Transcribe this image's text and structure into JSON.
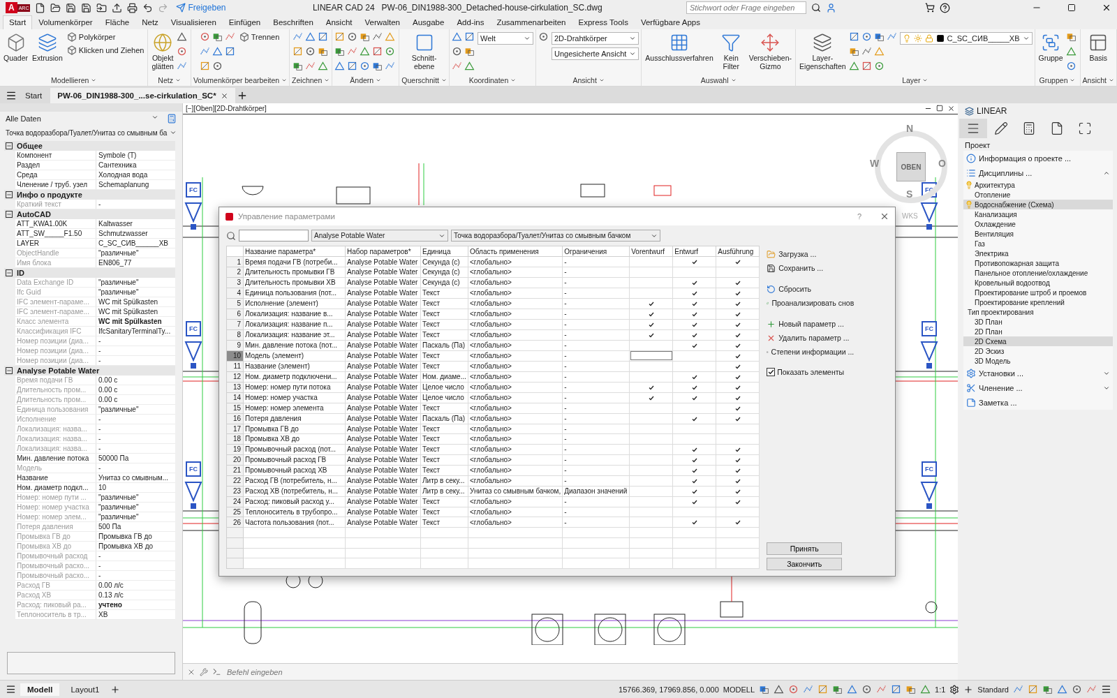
{
  "titlebar": {
    "app_letter": "A",
    "app_badge": "ARC",
    "share": "Freigeben",
    "app_name": "LINEAR CAD 24",
    "file_name": "PW-06_DIN1988-300_Detached-house-cirkulation_SC.dwg",
    "search_placeholder": "Stichwort oder Frage eingeben"
  },
  "ribbon_tabs": [
    {
      "label": "Start",
      "selected": true
    },
    {
      "label": "Volumenkörper",
      "selected": false
    },
    {
      "label": "Fläche",
      "selected": false
    },
    {
      "label": "Netz",
      "selected": false
    },
    {
      "label": "Visualisieren",
      "selected": false
    },
    {
      "label": "Einfügen",
      "selected": false
    },
    {
      "label": "Beschriften",
      "selected": false
    },
    {
      "label": "Ansicht",
      "selected": false
    },
    {
      "label": "Verwalten",
      "selected": false
    },
    {
      "label": "Ausgabe",
      "selected": false
    },
    {
      "label": "Add-ins",
      "selected": false
    },
    {
      "label": "Zusammenarbeiten",
      "selected": false
    },
    {
      "label": "Express Tools",
      "selected": false
    },
    {
      "label": "Verfügbare Apps",
      "selected": false
    }
  ],
  "ribbon_groups": [
    {
      "label": "Modellieren",
      "items": [
        {
          "kind": "large",
          "label": "Quader"
        },
        {
          "kind": "large",
          "label": "Extrusion"
        },
        {
          "kind": "small",
          "label": "Polykörper"
        },
        {
          "kind": "small",
          "label": "Klicken und Ziehen"
        }
      ]
    },
    {
      "label": "Netz",
      "items": [
        {
          "kind": "large",
          "label": "Objekt\nglätten"
        }
      ]
    },
    {
      "label": "Volumenkörper bearbeiten",
      "items": [
        {
          "kind": "small",
          "label": "Trennen"
        }
      ]
    },
    {
      "label": "Zeichnen"
    },
    {
      "label": "Ändern"
    },
    {
      "label": "Querschnitt",
      "items": [
        {
          "kind": "large",
          "label": "Schnitt-\nebene"
        }
      ]
    },
    {
      "label": "Koordinaten",
      "items": [
        {
          "kind": "select",
          "label": "Welt"
        }
      ]
    },
    {
      "label": "Ansicht",
      "items": [
        {
          "kind": "select",
          "label": "2D-Drahtkörper"
        },
        {
          "kind": "select",
          "label": "Ungesicherte Ansicht"
        }
      ]
    },
    {
      "label": "Auswahl",
      "items": [
        {
          "kind": "large",
          "label": "Ausschlussverfahren"
        },
        {
          "kind": "large",
          "label": "Kein Filter"
        },
        {
          "kind": "large",
          "label": "Verschieben-\nGizmo"
        }
      ]
    },
    {
      "label": "Layer",
      "items": [
        {
          "kind": "large",
          "label": "Layer-\nEigenschaften"
        },
        {
          "kind": "layer_select",
          "label": "C_SC_СИВ_____XB"
        }
      ]
    },
    {
      "label": "Gruppen",
      "items": [
        {
          "kind": "large",
          "label": "Gruppe"
        }
      ]
    },
    {
      "label": "Ansicht",
      "items": [
        {
          "kind": "large",
          "label": "Basis"
        }
      ]
    }
  ],
  "doc_tabs": [
    {
      "label": "Start",
      "selected": false
    },
    {
      "label": "PW-06_DIN1988-300_...se-cirkulation_SC*",
      "selected": true
    }
  ],
  "properties": {
    "filter": "Alle Daten",
    "path": "Точка водоразбора/Туалет/Унитаз со смывным ба",
    "sections": [
      {
        "title": "Общее",
        "expanded": true,
        "rows": [
          {
            "name": "Компонент",
            "value": "Symbole (T)",
            "disabled": false,
            "bold": false
          },
          {
            "name": "Раздел",
            "value": "Сантехника",
            "disabled": false,
            "bold": false
          },
          {
            "name": "Среда",
            "value": "Холодная вода",
            "disabled": false,
            "bold": false
          },
          {
            "name": "Членение / труб. узел",
            "value": "Schemaplanung",
            "disabled": false,
            "bold": false
          }
        ]
      },
      {
        "title": "Инфо о продукте",
        "expanded": true,
        "rows": [
          {
            "name": "Краткий текст",
            "value": "-",
            "disabled": true,
            "bold": false
          }
        ]
      },
      {
        "title": "AutoCAD",
        "expanded": true,
        "rows": [
          {
            "name": "ATT_KWA1.00K",
            "value": "Kaltwasser",
            "disabled": false,
            "bold": false
          },
          {
            "name": "ATT_SW_____F1.50",
            "value": "Schmutzwasser",
            "disabled": false,
            "bold": false
          },
          {
            "name": "LAYER",
            "value": "C_SC_СИВ______XB",
            "disabled": false,
            "bold": false
          },
          {
            "name": "ObjectHandle",
            "value": "\"различные\"",
            "disabled": true,
            "bold": false
          },
          {
            "name": "Имя блока",
            "value": "EN806_77",
            "disabled": true,
            "bold": false
          }
        ]
      },
      {
        "title": "ID",
        "expanded": true,
        "rows": [
          {
            "name": "Data Exchange ID",
            "value": "\"различные\"",
            "disabled": true,
            "bold": false
          },
          {
            "name": "Ifc Guid",
            "value": "\"различные\"",
            "disabled": true,
            "bold": false
          },
          {
            "name": "IFC элемент-параме...",
            "value": "WC mit Spülkasten",
            "disabled": true,
            "bold": false
          },
          {
            "name": "IFC элемент-параме...",
            "value": "WC mit Spülkasten",
            "disabled": true,
            "bold": false
          },
          {
            "name": "Класс элемента",
            "value": "WC mit Spülkasten",
            "disabled": true,
            "bold": true
          },
          {
            "name": "Классификация IFC",
            "value": "IfcSanitaryTerminalTy...",
            "disabled": true,
            "bold": false
          },
          {
            "name": "Номер позиции (диа...",
            "value": "-",
            "disabled": true,
            "bold": false
          },
          {
            "name": "Номер позиции (диа...",
            "value": "-",
            "disabled": true,
            "bold": false
          },
          {
            "name": "Номер позиции (диа...",
            "value": "-",
            "disabled": true,
            "bold": false
          }
        ]
      },
      {
        "title": "Analyse Potable Water",
        "expanded": true,
        "rows": [
          {
            "name": "Время подачи ГВ",
            "value": "0.00 с",
            "disabled": true,
            "bold": false
          },
          {
            "name": "Длительность пром...",
            "value": "0.00 с",
            "disabled": true,
            "bold": false
          },
          {
            "name": "Длительность пром...",
            "value": "0.00 с",
            "disabled": true,
            "bold": false
          },
          {
            "name": "Единица пользования",
            "value": "\"различные\"",
            "disabled": true,
            "bold": false
          },
          {
            "name": "Исполнение",
            "value": "-",
            "disabled": true,
            "bold": false
          },
          {
            "name": "Локализация: назва...",
            "value": "-",
            "disabled": true,
            "bold": false
          },
          {
            "name": "Локализация: назва...",
            "value": "-",
            "disabled": true,
            "bold": false
          },
          {
            "name": "Локализация: назва...",
            "value": "-",
            "disabled": true,
            "bold": false
          },
          {
            "name": "Мин. давление потока",
            "value": "50000 Па",
            "disabled": false,
            "bold": false
          },
          {
            "name": "Модель",
            "value": "-",
            "disabled": true,
            "bold": false
          },
          {
            "name": "Название",
            "value": "Унитаз со смывным...",
            "disabled": false,
            "bold": false
          },
          {
            "name": "Ном. диаметр подкл...",
            "value": "10",
            "disabled": false,
            "bold": false
          },
          {
            "name": "Номер: номер пути ...",
            "value": "\"различные\"",
            "disabled": true,
            "bold": false
          },
          {
            "name": "Номер: номер участка",
            "value": "\"различные\"",
            "disabled": true,
            "bold": false
          },
          {
            "name": "Номер: номер элем...",
            "value": "\"различные\"",
            "disabled": true,
            "bold": false
          },
          {
            "name": "Потеря давления",
            "value": "500 Па",
            "disabled": true,
            "bold": false
          },
          {
            "name": "Промывка ГВ до",
            "value": "Промывка ГВ до",
            "disabled": true,
            "bold": false
          },
          {
            "name": "Промывка ХВ до",
            "value": "Промывка ХВ до",
            "disabled": true,
            "bold": false
          },
          {
            "name": "Промывочный расход",
            "value": "-",
            "disabled": true,
            "bold": false
          },
          {
            "name": "Промывочный расхо...",
            "value": "-",
            "disabled": true,
            "bold": false
          },
          {
            "name": "Промывочный расхо...",
            "value": "-",
            "disabled": true,
            "bold": false
          },
          {
            "name": "Расход ГВ",
            "value": "0.00 л/с",
            "disabled": true,
            "bold": false
          },
          {
            "name": "Расход ХВ",
            "value": "0.13 л/с",
            "disabled": true,
            "bold": false
          },
          {
            "name": "Расход: пиковый ра...",
            "value": "учтено",
            "disabled": true,
            "bold": true
          },
          {
            "name": "Теплоноситель в тр...",
            "value": "ХВ",
            "disabled": true,
            "bold": false
          }
        ]
      }
    ]
  },
  "canvas": {
    "view_label": "[−][Oben][2D-Drahtkörper]",
    "tags": [
      "FC",
      "FC",
      "FC",
      "FC",
      "FC",
      "FC"
    ],
    "viewcube": {
      "north": "N",
      "west": "W",
      "top": "OBEN",
      "east": "O",
      "south": "S",
      "ucs": "WKS"
    },
    "command_placeholder": "Befehl eingeben"
  },
  "dialog": {
    "title": "Управление параметрами",
    "help": "?",
    "parameter_set": "Analyse Potable Water",
    "element_path": "Точка водоразбора/Туалет/Унитаз со смывным бачком",
    "columns": [
      "Название параметра*",
      "Набор параметров*",
      "Единица",
      "Область применения",
      "Ограничения",
      "Vorentwurf",
      "Entwurf",
      "Ausführung"
    ],
    "rows": [
      {
        "no": "1",
        "name": "Время подачи ГВ (потреби...",
        "set": "Analyse Potable Water",
        "unit": "Секунда (с)",
        "scope": "<глобально>",
        "limit": "-",
        "checks": [
          false,
          true,
          true
        ],
        "selected": false
      },
      {
        "no": "2",
        "name": "Длительность промывки ГВ",
        "set": "Analyse Potable Water",
        "unit": "Секунда (с)",
        "scope": "<глобально>",
        "limit": "-",
        "checks": [
          false,
          false,
          false
        ],
        "selected": false
      },
      {
        "no": "3",
        "name": "Длительность промывки ХВ",
        "set": "Analyse Potable Water",
        "unit": "Секунда (с)",
        "scope": "<глобально>",
        "limit": "-",
        "checks": [
          false,
          true,
          true
        ],
        "selected": false
      },
      {
        "no": "4",
        "name": "Единица пользования (пот...",
        "set": "Analyse Potable Water",
        "unit": "Текст",
        "scope": "<глобально>",
        "limit": "-",
        "checks": [
          false,
          true,
          true
        ],
        "selected": false
      },
      {
        "no": "5",
        "name": "Исполнение (элемент)",
        "set": "Analyse Potable Water",
        "unit": "Текст",
        "scope": "<глобально>",
        "limit": "-",
        "checks": [
          true,
          true,
          true
        ],
        "selected": false
      },
      {
        "no": "6",
        "name": "Локализация: название в...",
        "set": "Analyse Potable Water",
        "unit": "Текст",
        "scope": "<глобально>",
        "limit": "-",
        "checks": [
          true,
          true,
          true
        ],
        "selected": false
      },
      {
        "no": "7",
        "name": "Локализация: название п...",
        "set": "Analyse Potable Water",
        "unit": "Текст",
        "scope": "<глобально>",
        "limit": "-",
        "checks": [
          true,
          true,
          true
        ],
        "selected": false
      },
      {
        "no": "8",
        "name": "Локализация: название эт...",
        "set": "Analyse Potable Water",
        "unit": "Текст",
        "scope": "<глобально>",
        "limit": "-",
        "checks": [
          true,
          true,
          true
        ],
        "selected": false
      },
      {
        "no": "9",
        "name": "Мин. давление потока (пот...",
        "set": "Analyse Potable Water",
        "unit": "Паскаль (Па)",
        "scope": "<глобально>",
        "limit": "-",
        "checks": [
          false,
          true,
          true
        ],
        "selected": false
      },
      {
        "no": "10",
        "name": "Модель (элемент)",
        "set": "Analyse Potable Water",
        "unit": "Текст",
        "scope": "<глобально>",
        "limit": "-",
        "checks": [
          false,
          false,
          true
        ],
        "selected": true
      },
      {
        "no": "11",
        "name": "Название (элемент)",
        "set": "Analyse Potable Water",
        "unit": "Текст",
        "scope": "<глобально>",
        "limit": "-",
        "checks": [
          false,
          false,
          true
        ],
        "selected": false
      },
      {
        "no": "12",
        "name": "Ном. диаметр подключени...",
        "set": "Analyse Potable Water",
        "unit": "Ном. диаме...",
        "scope": "<глобально>",
        "limit": "-",
        "checks": [
          false,
          true,
          true
        ],
        "selected": false
      },
      {
        "no": "13",
        "name": "Номер: номер пути потока",
        "set": "Analyse Potable Water",
        "unit": "Целое число",
        "scope": "<глобально>",
        "limit": "-",
        "checks": [
          true,
          true,
          true
        ],
        "selected": false
      },
      {
        "no": "14",
        "name": "Номер: номер участка",
        "set": "Analyse Potable Water",
        "unit": "Целое число",
        "scope": "<глобально>",
        "limit": "-",
        "checks": [
          true,
          true,
          true
        ],
        "selected": false
      },
      {
        "no": "15",
        "name": "Номер: номер элемента",
        "set": "Analyse Potable Water",
        "unit": "Текст",
        "scope": "<глобально>",
        "limit": "-",
        "checks": [
          false,
          false,
          true
        ],
        "selected": false
      },
      {
        "no": "16",
        "name": "Потеря давления",
        "set": "Analyse Potable Water",
        "unit": "Паскаль (Па)",
        "scope": "<глобально>",
        "limit": "-",
        "checks": [
          false,
          true,
          true
        ],
        "selected": false
      },
      {
        "no": "17",
        "name": "Промывка ГВ до",
        "set": "Analyse Potable Water",
        "unit": "Текст",
        "scope": "<глобально>",
        "limit": "-",
        "checks": [
          false,
          false,
          false
        ],
        "selected": false
      },
      {
        "no": "18",
        "name": "Промывка ХВ до",
        "set": "Analyse Potable Water",
        "unit": "Текст",
        "scope": "<глобально>",
        "limit": "-",
        "checks": [
          false,
          false,
          false
        ],
        "selected": false
      },
      {
        "no": "19",
        "name": "Промывочный расход (пот...",
        "set": "Analyse Potable Water",
        "unit": "Текст",
        "scope": "<глобально>",
        "limit": "-",
        "checks": [
          false,
          true,
          true
        ],
        "selected": false
      },
      {
        "no": "20",
        "name": "Промывочный расход ГВ",
        "set": "Analyse Potable Water",
        "unit": "Текст",
        "scope": "<глобально>",
        "limit": "-",
        "checks": [
          false,
          true,
          true
        ],
        "selected": false
      },
      {
        "no": "21",
        "name": "Промывочный расход ХВ",
        "set": "Analyse Potable Water",
        "unit": "Текст",
        "scope": "<глобально>",
        "limit": "-",
        "checks": [
          false,
          true,
          true
        ],
        "selected": false
      },
      {
        "no": "22",
        "name": "Расход ГВ (потребитель, н...",
        "set": "Analyse Potable Water",
        "unit": "Литр в секу...",
        "scope": "<глобально>",
        "limit": "-",
        "checks": [
          false,
          true,
          true
        ],
        "selected": false
      },
      {
        "no": "23",
        "name": "Расход ХВ (потребитель, н...",
        "set": "Analyse Potable Water",
        "unit": "Литр в секу...",
        "scope": "Унитаз со смывным бачком,",
        "limit": "Диапазон значений",
        "checks": [
          false,
          true,
          true
        ],
        "selected": false
      },
      {
        "no": "24",
        "name": "Расход: пиковый расход у...",
        "set": "Analyse Potable Water",
        "unit": "Текст",
        "scope": "<глобально>",
        "limit": "-",
        "checks": [
          false,
          true,
          true
        ],
        "selected": false
      },
      {
        "no": "25",
        "name": "Теплоноситель в трубопро...",
        "set": "Analyse Potable Water",
        "unit": "Текст",
        "scope": "<глобально>",
        "limit": "-",
        "checks": [
          false,
          false,
          false
        ],
        "selected": false
      },
      {
        "no": "26",
        "name": "Частота пользования (пот...",
        "set": "Analyse Potable Water",
        "unit": "Текст",
        "scope": "<глобально>",
        "limit": "-",
        "checks": [
          false,
          true,
          true
        ],
        "selected": false
      }
    ],
    "actions": [
      "Загрузка ...",
      "Сохранить ...",
      "Сбросить",
      "Проанализировать снов",
      "Новый параметр ...",
      "Удалить параметр ...",
      "Степени информации ..."
    ],
    "show_elements": {
      "label": "Показать элементы",
      "checked": true
    },
    "buttons": [
      "Принять",
      "Закончить"
    ]
  },
  "project_panel": {
    "brand": "LINEAR",
    "tool_tabs": [
      {
        "selected": true
      },
      {
        "selected": false
      },
      {
        "selected": false
      },
      {
        "selected": false
      },
      {
        "selected": false
      }
    ],
    "title": "Проект",
    "items": [
      {
        "label": "Информация о проекте ..."
      },
      {
        "label": "Дисциплины ...",
        "expanded": true,
        "children": [
          {
            "label": "Архитектура",
            "lamp": true,
            "selected": false
          },
          {
            "label": "Отопление",
            "lamp": false,
            "selected": false
          },
          {
            "label": "Водоснабжение (Схема)",
            "lamp": true,
            "selected": true
          },
          {
            "label": "Канализация",
            "lamp": false,
            "selected": false
          },
          {
            "label": "Охлаждение",
            "lamp": false,
            "selected": false
          },
          {
            "label": "Вентиляция",
            "lamp": false,
            "selected": false
          },
          {
            "label": "Газ",
            "lamp": false,
            "selected": false
          },
          {
            "label": "Электрика",
            "lamp": false,
            "selected": false
          },
          {
            "label": "Противопожарная защита",
            "lamp": false,
            "selected": false
          },
          {
            "label": "Панельное отопление/охлаждение",
            "lamp": false,
            "selected": false
          },
          {
            "label": "Кровельный водоотвод",
            "lamp": false,
            "selected": false
          },
          {
            "label": "Проектирование штроб и проемов",
            "lamp": false,
            "selected": false
          },
          {
            "label": "Проектирование креплений",
            "lamp": false,
            "selected": false
          }
        ],
        "types_title": "Тип проектирования",
        "types": [
          {
            "label": "3D План",
            "selected": false
          },
          {
            "label": "2D План",
            "selected": false
          },
          {
            "label": "2D Схема",
            "selected": true
          },
          {
            "label": "2D Эскиз",
            "selected": false
          },
          {
            "label": "3D Модель",
            "selected": false
          }
        ]
      },
      {
        "label": "Установки ...",
        "expanded": false
      },
      {
        "label": "Членение ...",
        "expanded": false
      },
      {
        "label": "Заметка ..."
      }
    ]
  },
  "status_bar": {
    "layouts": [
      {
        "label": "Modell",
        "selected": true
      },
      {
        "label": "Layout1",
        "selected": false
      }
    ],
    "coordinates": "15766.369, 17969.856, 0.000",
    "space": "MODELL",
    "scale": "1:1",
    "style": "Standard"
  }
}
